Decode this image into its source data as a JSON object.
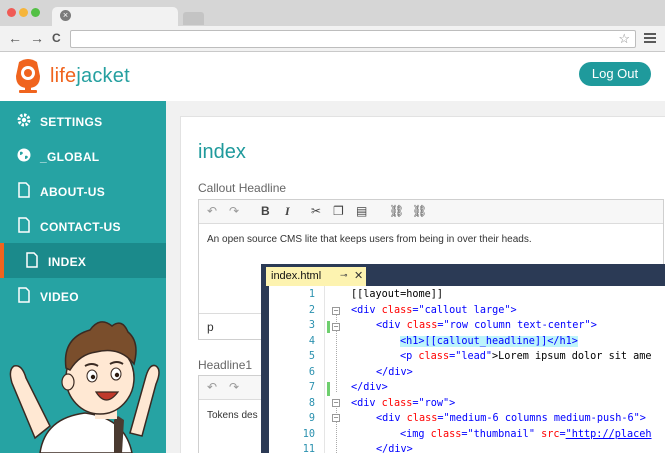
{
  "browser": {
    "dots": [
      "#f05b55",
      "#f6b53a",
      "#53c045"
    ],
    "close_glyph": "×",
    "nav": {
      "back": "←",
      "forward": "→",
      "reload": "C"
    },
    "star_glyph": "☆"
  },
  "app": {
    "logo_life": "life",
    "logo_jacket": "jacket",
    "logout_label": "Log Out",
    "brand_orange": "#f0641e",
    "brand_teal": "#26a3a3"
  },
  "sidebar": {
    "items": [
      {
        "label": "SETTINGS",
        "icon": "gear-icon"
      },
      {
        "label": "_GLOBAL",
        "icon": "globe-icon"
      },
      {
        "label": "ABOUT-US",
        "icon": "file-icon"
      },
      {
        "label": "CONTACT-US",
        "icon": "file-icon"
      },
      {
        "label": "INDEX",
        "icon": "file-icon",
        "active": true
      },
      {
        "label": "VIDEO",
        "icon": "file-icon"
      }
    ]
  },
  "main": {
    "title": "index",
    "field1_label": "Callout Headline",
    "field1_value": "An open source CMS lite that keeps users from being in over their heads.",
    "field1_path": "p",
    "field2_label": "Headline1",
    "field2_value": "Tokens des"
  },
  "code": {
    "tab_label": "index.html",
    "pin_glyph": "⊸",
    "close_glyph": "✕",
    "line_numbers": [
      "1",
      "2",
      "3",
      "4",
      "5",
      "6",
      "7",
      "8",
      "9",
      "10",
      "11"
    ],
    "lines": {
      "l1": "[[layout=home]]",
      "l2_open": "<div ",
      "l2_attr": "class",
      "l2_eq": "=",
      "l2_val": "\"callout large\"",
      "l2_close": ">",
      "l3_open": "<div ",
      "l3_attr": "class",
      "l3_eq": "=",
      "l3_val": "\"row column text-center\"",
      "l3_close": ">",
      "l4": "<h1>[[callout_headline]]</h1>",
      "l5_open": "<p ",
      "l5_attr": "class",
      "l5_eq": "=",
      "l5_val": "\"lead\"",
      "l5_text": ">Lorem ipsum dolor sit ame",
      "l6": "</div>",
      "l7": "</div>",
      "l8_open": "<div ",
      "l8_attr": "class",
      "l8_eq": "=",
      "l8_val": "\"row\"",
      "l8_close": ">",
      "l9_open": "<div ",
      "l9_attr": "class",
      "l9_eq": "=",
      "l9_val": "\"medium-6 columns medium-push-6\"",
      "l9_close": ">",
      "l10_open": "<img ",
      "l10_attr": "class",
      "l10_eq": "=",
      "l10_val": "\"thumbnail\"",
      "l10_attr2": " src",
      "l10_eq2": "=",
      "l10_url": "\"http://placeh",
      "l11": "</div>"
    }
  }
}
